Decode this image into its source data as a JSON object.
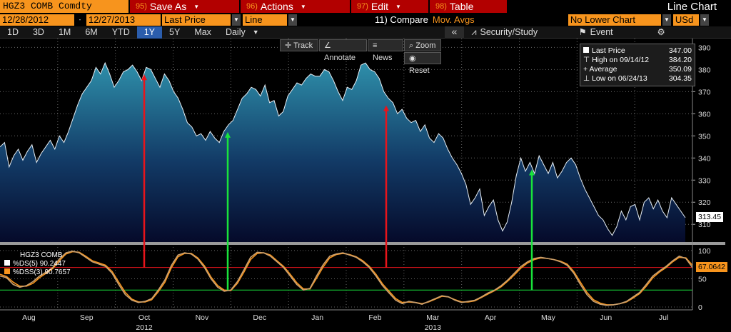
{
  "header": {
    "ticker": "HGZ3 COMB Comdty",
    "menus": [
      {
        "num": "95)",
        "label": "Save As"
      },
      {
        "num": "96)",
        "label": "Actions"
      },
      {
        "num": "97)",
        "label": "Edit"
      },
      {
        "num": "98)",
        "label": "Table"
      }
    ],
    "title": "Line Chart"
  },
  "toolbar": {
    "start_date": "12/28/2012",
    "end_date": "12/27/2013",
    "field": "Last Price",
    "chart_kind": "Line",
    "compare_label": "11) Compare",
    "compare_value": "Mov. Avgs",
    "lower_chart": "No Lower Chart",
    "currency": "USd"
  },
  "ranges": {
    "buttons": [
      "1D",
      "3D",
      "1M",
      "6M",
      "YTD",
      "1Y",
      "5Y",
      "Max"
    ],
    "active": "1Y",
    "period": "Daily",
    "collapse": "«",
    "security_study": "Security/Study",
    "event": "Event",
    "settings": "⚙"
  },
  "chart_tools": {
    "track": "Track",
    "annotate": "Annotate",
    "news": "News",
    "zoom": "Zoom",
    "reset": "Reset"
  },
  "legend": {
    "last_label": "Last Price",
    "last_value": "347.00",
    "high_label": "High on 09/14/12",
    "high_value": "384.20",
    "avg_label": "Average",
    "avg_value": "350.09",
    "low_label": "Low on 06/24/13",
    "low_value": "304.35"
  },
  "price_label": "313.45",
  "stoch": {
    "title": "HGZ3 COMB",
    "ds_label": "%DS(5)",
    "ds_value": "90.2447",
    "dss_label": "%DSS(3)",
    "dss_value": "90.7657",
    "last_label": "67.0642",
    "color_ds": "#ffffff",
    "color_dss": "#f7941d"
  },
  "colors": {
    "accent": "#f7941d",
    "menu_bg": "#b20000",
    "active_range": "#2b5dac",
    "area_top": "#2e8faa",
    "area_bottom": "#050a2a",
    "sell_arrow": "#e8141b",
    "buy_arrow": "#19e33b"
  },
  "chart_data": {
    "type": "area",
    "y_axis_price": {
      "ticks": [
        310,
        320,
        330,
        340,
        350,
        360,
        370,
        380,
        390
      ],
      "ylim": [
        302,
        394
      ]
    },
    "y_axis_stoch": {
      "ticks": [
        0,
        50,
        100
      ],
      "ylim": [
        -5,
        110
      ],
      "lines": [
        30,
        70
      ]
    },
    "x_labels": [
      "Aug",
      "Sep",
      "Oct",
      "Nov",
      "Dec",
      "Jan",
      "Feb",
      "Mar",
      "Apr",
      "May",
      "Jun",
      "Jul"
    ],
    "year_labels": [
      "2012",
      "2013"
    ],
    "price": [
      345,
      347,
      336,
      341,
      344,
      339,
      343,
      346,
      338,
      342,
      345,
      348,
      344,
      350,
      347,
      352,
      358,
      364,
      369,
      372,
      375,
      381,
      378,
      383,
      378,
      372,
      375,
      379,
      380,
      382,
      379,
      375,
      381,
      380,
      376,
      372,
      378,
      375,
      370,
      367,
      362,
      356,
      354,
      350,
      351,
      348,
      352,
      349,
      347,
      352,
      355,
      357,
      362,
      367,
      369,
      372,
      371,
      368,
      373,
      365,
      366,
      359,
      361,
      368,
      371,
      374,
      373,
      376,
      378,
      377,
      377,
      380,
      379,
      375,
      370,
      366,
      372,
      371,
      375,
      382,
      383,
      380,
      379,
      376,
      370,
      367,
      365,
      360,
      362,
      358,
      356,
      357,
      352,
      355,
      349,
      347,
      351,
      349,
      344,
      340,
      337,
      333,
      328,
      319,
      322,
      326,
      314,
      318,
      321,
      312,
      307,
      311,
      320,
      332,
      340,
      334,
      338,
      333,
      341,
      337,
      333,
      338,
      331,
      334,
      338,
      340,
      337,
      331,
      326,
      322,
      318,
      314,
      312,
      308,
      305,
      309,
      316,
      312,
      318,
      319,
      312,
      320,
      322,
      317,
      321,
      316,
      313,
      322,
      319,
      316,
      313
    ],
    "stoch_ds": [
      55,
      52,
      40,
      35,
      38,
      45,
      55,
      62,
      70,
      85,
      96,
      99,
      96,
      88,
      80,
      76,
      72,
      60,
      40,
      22,
      12,
      8,
      10,
      15,
      30,
      48,
      74,
      92,
      96,
      94,
      85,
      70,
      50,
      35,
      28,
      30,
      45,
      66,
      88,
      97,
      96,
      90,
      80,
      70,
      55,
      40,
      30,
      33,
      55,
      75,
      90,
      94,
      96,
      92,
      88,
      80,
      70,
      55,
      38,
      25,
      12,
      6,
      10,
      8,
      5,
      10,
      15,
      20,
      18,
      12,
      8,
      10,
      12,
      18,
      25,
      30,
      38,
      48,
      60,
      72,
      80,
      86,
      88,
      86,
      84,
      80,
      74,
      60,
      40,
      22,
      10,
      5,
      3,
      4,
      6,
      10,
      18,
      26,
      40,
      55,
      64,
      72,
      82,
      90,
      86,
      70
    ],
    "stoch_dss": [
      58,
      54,
      44,
      37,
      37,
      42,
      52,
      60,
      68,
      82,
      94,
      98,
      97,
      90,
      82,
      78,
      74,
      63,
      44,
      26,
      14,
      9,
      9,
      13,
      27,
      44,
      70,
      89,
      95,
      95,
      87,
      73,
      53,
      38,
      30,
      29,
      42,
      62,
      84,
      95,
      96,
      92,
      82,
      72,
      58,
      43,
      32,
      32,
      51,
      71,
      87,
      93,
      95,
      93,
      89,
      82,
      72,
      58,
      41,
      28,
      15,
      8,
      9,
      8,
      6,
      9,
      14,
      19,
      18,
      13,
      9,
      9,
      11,
      17,
      23,
      29,
      36,
      46,
      57,
      69,
      78,
      84,
      87,
      86,
      84,
      81,
      76,
      63,
      44,
      26,
      13,
      7,
      4,
      4,
      6,
      9,
      16,
      24,
      37,
      52,
      62,
      70,
      80,
      88,
      87,
      74
    ],
    "signals": [
      {
        "kind": "sell",
        "month": "Oct"
      },
      {
        "kind": "buy",
        "month": "Nov"
      },
      {
        "kind": "sell",
        "month": "Feb"
      },
      {
        "kind": "buy",
        "month": "Apr"
      }
    ]
  }
}
